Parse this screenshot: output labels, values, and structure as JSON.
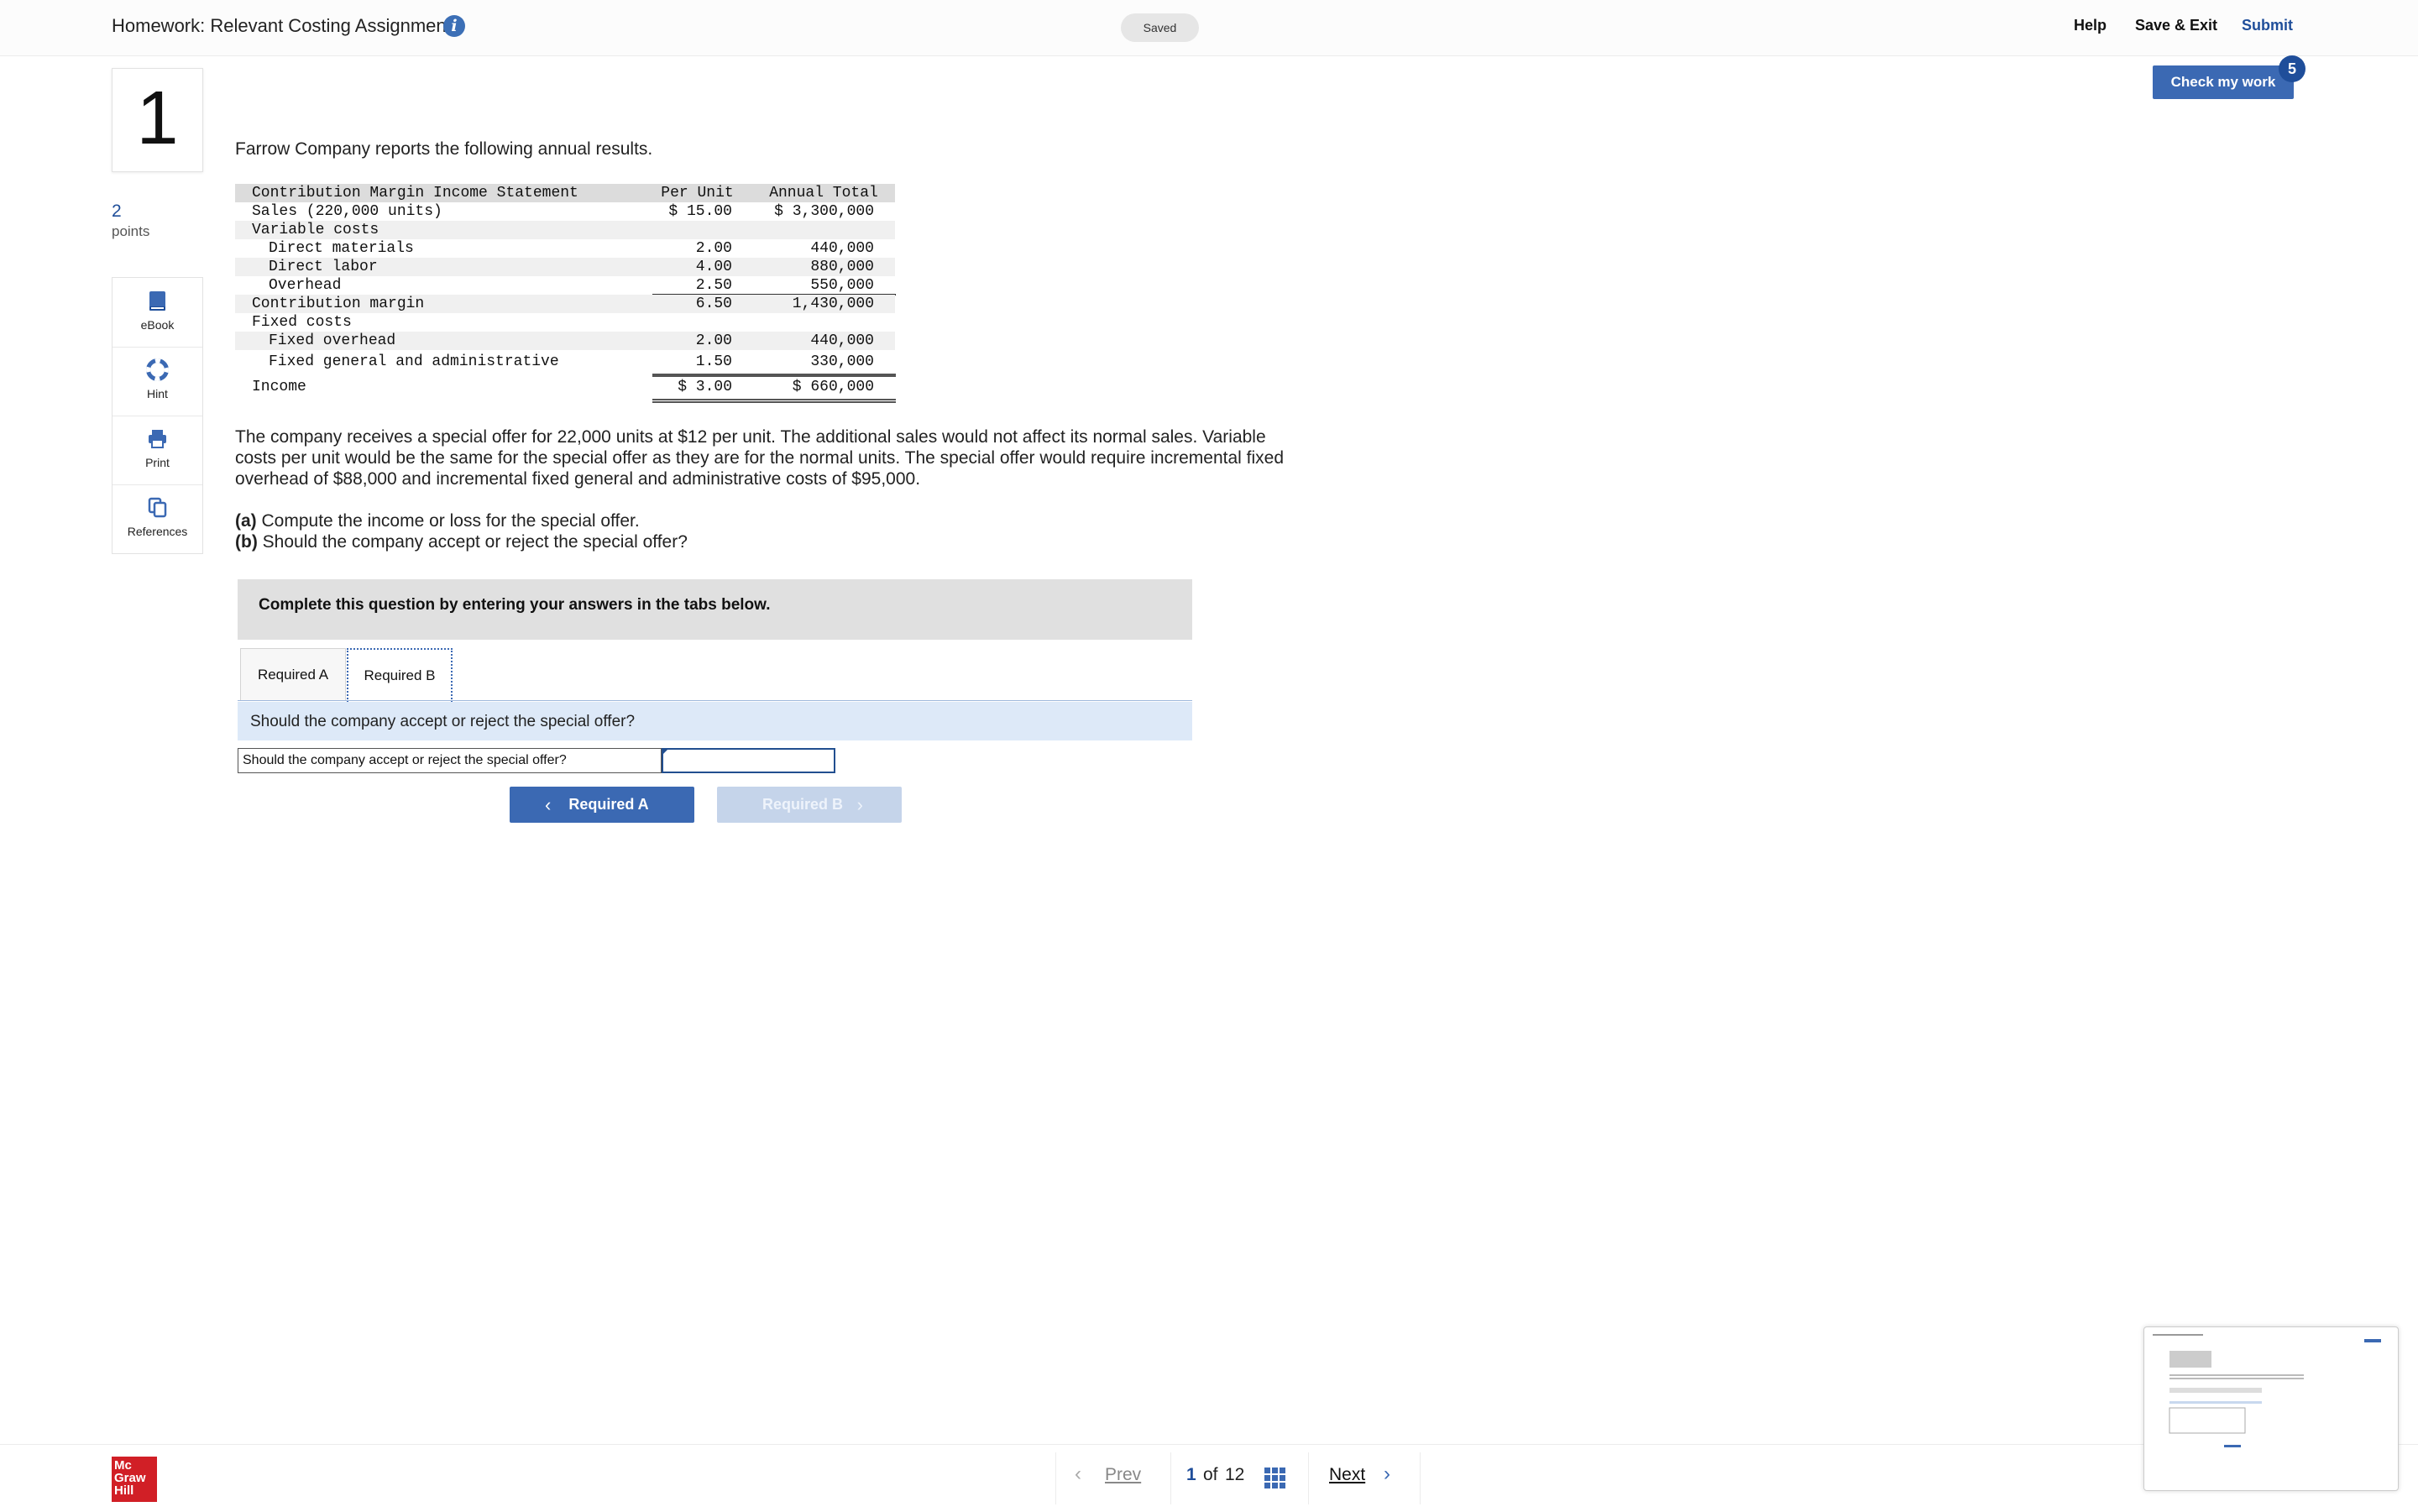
{
  "header": {
    "title": "Homework: Relevant Costing Assignment",
    "saved": "Saved",
    "help": "Help",
    "save_exit": "Save & Exit",
    "submit": "Submit"
  },
  "question": {
    "number": "1",
    "points_value": "2",
    "points_label": "points",
    "check_label": "Check my work",
    "check_badge": "5"
  },
  "tools": [
    {
      "label": "eBook",
      "icon": "book-icon"
    },
    {
      "label": "Hint",
      "icon": "lifebuoy-icon"
    },
    {
      "label": "Print",
      "icon": "printer-icon"
    },
    {
      "label": "References",
      "icon": "copy-icon"
    }
  ],
  "content": {
    "intro": "Farrow Company reports the following annual results.",
    "table": {
      "header": [
        "Contribution Margin Income Statement",
        "Per Unit",
        "Annual Total"
      ],
      "rows": [
        [
          "Sales (220,000 units)",
          "$ 15.00",
          "$ 3,300,000"
        ],
        [
          "Variable costs",
          "",
          ""
        ],
        [
          "Direct materials",
          "2.00",
          "440,000"
        ],
        [
          "Direct labor",
          "4.00",
          "880,000"
        ],
        [
          "Overhead",
          "2.50",
          "550,000"
        ],
        [
          "Contribution margin",
          "6.50",
          "1,430,000"
        ],
        [
          "Fixed costs",
          "",
          ""
        ],
        [
          "Fixed overhead",
          "2.00",
          "440,000"
        ],
        [
          "Fixed general and administrative",
          "1.50",
          "330,000"
        ],
        [
          "Income",
          "$ 3.00",
          "$ 660,000"
        ]
      ]
    },
    "paragraph": "The company receives a special offer for 22,000 units at $12 per unit. The additional sales would not affect its normal sales. Variable costs per unit would be the same for the special offer as they are for the normal units. The special offer would require incremental fixed overhead of $88,000 and incremental fixed general and administrative costs of $95,000.",
    "part_a_tag": "(a)",
    "part_a": " Compute the income or loss for the special offer.",
    "part_b_tag": "(b)",
    "part_b": " Should the company accept or reject the special offer?"
  },
  "answer_section": {
    "instruction": "Complete this question by entering your answers in the tabs below.",
    "tabs": [
      "Required A",
      "Required B"
    ],
    "active_tab": "Required B",
    "prompt": "Should the company accept or reject the special offer?",
    "field_label": "Should the company accept or reject the special offer?",
    "field_value": "",
    "prev_button": "Required A",
    "next_button": "Required B"
  },
  "footer": {
    "logo": [
      "Mc",
      "Graw",
      "Hill"
    ],
    "prev": "Prev",
    "current_page": "1",
    "of": "of",
    "total_pages": "12",
    "next": "Next"
  },
  "colors": {
    "accent": "#3b69b3",
    "link": "#1f4e9a",
    "brand_red": "#d11f26"
  }
}
